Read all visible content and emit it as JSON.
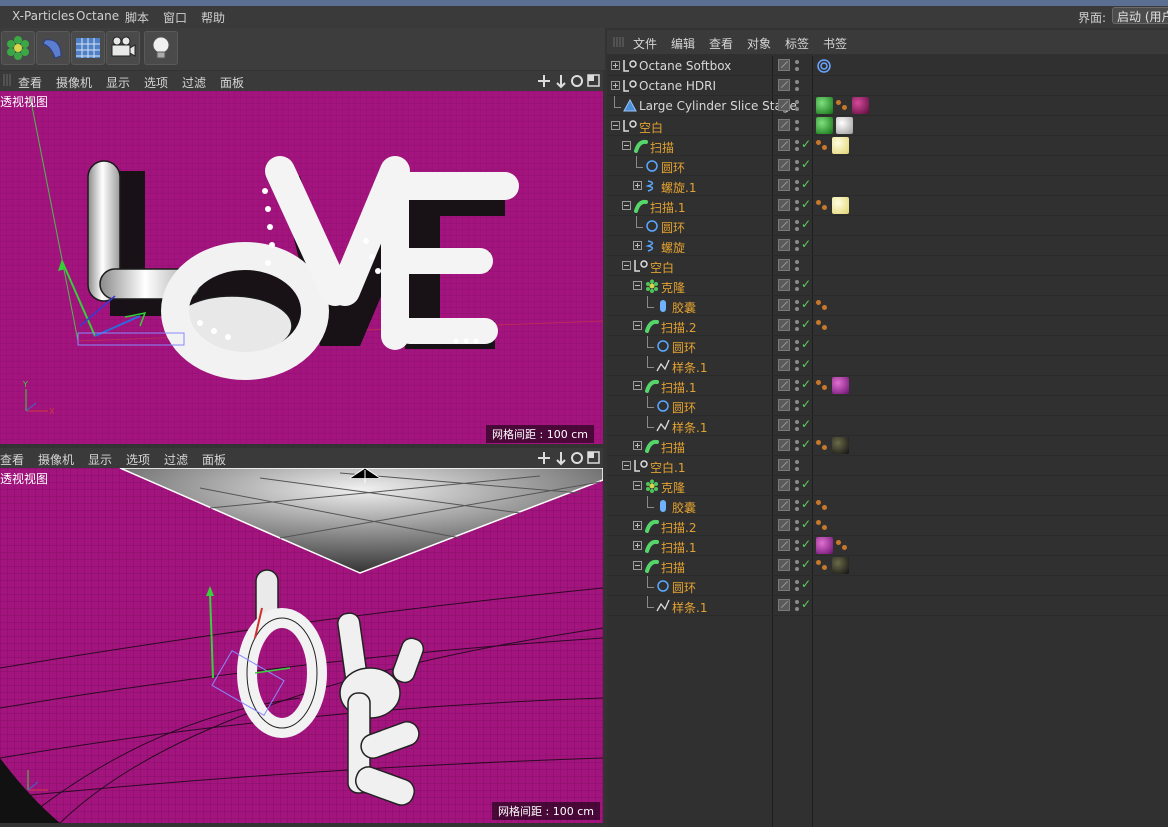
{
  "menubar": {
    "items": [
      "X-Particles",
      "Octane",
      "脚本",
      "窗口",
      "帮助"
    ],
    "layout_label": "界面:",
    "layout_value": "启动 (用户"
  },
  "toolbar": {
    "icons": [
      "mograph-cloner-icon",
      "deformer-icon",
      "floor-icon",
      "camera-icon",
      "light-icon"
    ]
  },
  "viewport_menu": [
    "查看",
    "摄像机",
    "显示",
    "选项",
    "过滤",
    "面板"
  ],
  "viewport_top": {
    "title": "透视视图",
    "grid_label": "网格间距 : 100 cm"
  },
  "viewport_bottom": {
    "title": "透视视图",
    "grid_label": "网格间距 : 100 cm"
  },
  "object_manager": {
    "menu": [
      "文件",
      "编辑",
      "查看",
      "对象",
      "标签",
      "书签"
    ],
    "rows": [
      {
        "name": "Octane Softbox",
        "color": "white",
        "icon": "null-icon",
        "indent": 0,
        "expander": "plus",
        "check": false,
        "tags": [
          "octane-target-tag"
        ]
      },
      {
        "name": "Octane HDRI",
        "color": "white",
        "icon": "null-icon",
        "indent": 0,
        "expander": "plus",
        "check": false,
        "tags": []
      },
      {
        "name": "Large Cylinder Slice Stage",
        "color": "white",
        "icon": "polygon-object-icon",
        "indent": 0,
        "expander": "none",
        "check": false,
        "tags": [
          "material-green",
          "phong-tag",
          "material-purple"
        ]
      },
      {
        "name": "空白",
        "color": "orange",
        "icon": "null-icon",
        "indent": 0,
        "expander": "minus",
        "check": false,
        "tags": [
          "material-green",
          "material-white"
        ]
      },
      {
        "name": "扫描",
        "color": "orange",
        "icon": "sweep-icon",
        "indent": 1,
        "expander": "minus",
        "check": true,
        "tags": [
          "phong-tag",
          "material-yellow"
        ]
      },
      {
        "name": "圆环",
        "color": "orange",
        "icon": "circle-spline-icon",
        "indent": 2,
        "expander": "none",
        "check": true,
        "tags": []
      },
      {
        "name": "螺旋.1",
        "color": "orange",
        "icon": "helix-icon",
        "indent": 2,
        "expander": "plus",
        "check": true,
        "tags": []
      },
      {
        "name": "扫描.1",
        "color": "orange",
        "icon": "sweep-icon",
        "indent": 1,
        "expander": "minus",
        "check": true,
        "tags": [
          "phong-tag",
          "material-yellow"
        ]
      },
      {
        "name": "圆环",
        "color": "orange",
        "icon": "circle-spline-icon",
        "indent": 2,
        "expander": "none",
        "check": true,
        "tags": []
      },
      {
        "name": "螺旋",
        "color": "orange",
        "icon": "helix-icon",
        "indent": 2,
        "expander": "plus",
        "check": true,
        "tags": []
      },
      {
        "name": "空白",
        "color": "orange",
        "icon": "null-icon",
        "indent": 1,
        "expander": "minus",
        "check": false,
        "tags": []
      },
      {
        "name": "克隆",
        "color": "orange",
        "icon": "cloner-icon",
        "indent": 2,
        "expander": "minus",
        "check": true,
        "tags": []
      },
      {
        "name": "胶囊",
        "color": "orange",
        "icon": "capsule-icon",
        "indent": 3,
        "expander": "none",
        "check": true,
        "tags": [
          "phong-tag"
        ]
      },
      {
        "name": "扫描.2",
        "color": "orange",
        "icon": "sweep-icon",
        "indent": 2,
        "expander": "minus",
        "check": true,
        "tags": [
          "phong-tag"
        ]
      },
      {
        "name": "圆环",
        "color": "orange",
        "icon": "circle-spline-icon",
        "indent": 3,
        "expander": "none",
        "check": true,
        "tags": []
      },
      {
        "name": "样条.1",
        "color": "orange",
        "icon": "spline-icon",
        "indent": 3,
        "expander": "none",
        "check": true,
        "tags": []
      },
      {
        "name": "扫描.1",
        "color": "orange",
        "icon": "sweep-icon",
        "indent": 2,
        "expander": "minus",
        "check": true,
        "tags": [
          "phong-tag",
          "material-pink"
        ]
      },
      {
        "name": "圆环",
        "color": "orange",
        "icon": "circle-spline-icon",
        "indent": 3,
        "expander": "none",
        "check": true,
        "tags": []
      },
      {
        "name": "样条.1",
        "color": "orange",
        "icon": "spline-icon",
        "indent": 3,
        "expander": "none",
        "check": true,
        "tags": []
      },
      {
        "name": "扫描",
        "color": "orange",
        "icon": "sweep-icon",
        "indent": 2,
        "expander": "plus",
        "check": true,
        "tags": [
          "phong-tag",
          "material-dark"
        ]
      },
      {
        "name": "空白.1",
        "color": "orange",
        "icon": "null-icon",
        "indent": 1,
        "expander": "minus",
        "check": false,
        "tags": []
      },
      {
        "name": "克隆",
        "color": "orange",
        "icon": "cloner-icon",
        "indent": 2,
        "expander": "minus",
        "check": true,
        "tags": []
      },
      {
        "name": "胶囊",
        "color": "orange",
        "icon": "capsule-icon",
        "indent": 3,
        "expander": "none",
        "check": true,
        "tags": [
          "phong-tag"
        ]
      },
      {
        "name": "扫描.2",
        "color": "orange",
        "icon": "sweep-icon",
        "indent": 2,
        "expander": "plus",
        "check": true,
        "tags": [
          "phong-tag"
        ]
      },
      {
        "name": "扫描.1",
        "color": "orange",
        "icon": "sweep-icon",
        "indent": 2,
        "expander": "plus",
        "check": true,
        "tags": [
          "material-pink",
          "phong-tag"
        ]
      },
      {
        "name": "扫描",
        "color": "orange",
        "icon": "sweep-icon",
        "indent": 2,
        "expander": "minus",
        "check": true,
        "tags": [
          "phong-tag",
          "material-dark"
        ]
      },
      {
        "name": "圆环",
        "color": "orange",
        "icon": "circle-spline-icon",
        "indent": 3,
        "expander": "none",
        "check": true,
        "tags": []
      },
      {
        "name": "样条.1",
        "color": "orange",
        "icon": "spline-icon",
        "indent": 3,
        "expander": "none",
        "check": true,
        "tags": []
      }
    ]
  },
  "colors": {
    "viewport_bg": "#a4147f",
    "accent_orange": "#e3a231",
    "check_green": "#5bd35b"
  }
}
